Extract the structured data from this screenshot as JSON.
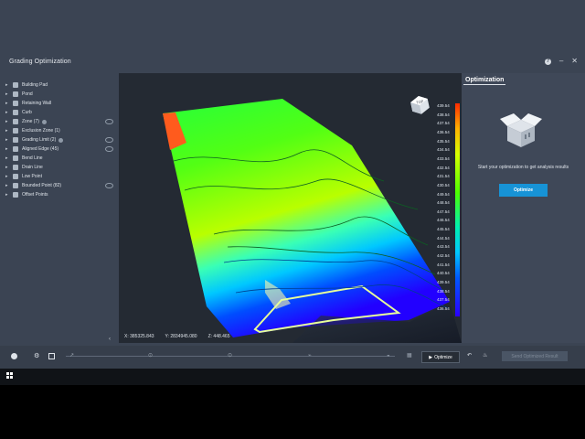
{
  "app": {
    "title": "Grading Optimization"
  },
  "window_controls": {
    "help": "?",
    "minimize": "–",
    "close": "✕"
  },
  "sidebar": {
    "items": [
      {
        "label": "Building Pad",
        "icon": "building-pad-icon",
        "info": false,
        "eye": false
      },
      {
        "label": "Pond",
        "icon": "pond-icon",
        "info": false,
        "eye": false
      },
      {
        "label": "Retaining Wall",
        "icon": "retaining-wall-icon",
        "info": false,
        "eye": false
      },
      {
        "label": "Curb",
        "icon": "curb-icon",
        "info": false,
        "eye": false
      },
      {
        "label": "Zone (7)",
        "icon": "zone-icon",
        "info": true,
        "eye": true
      },
      {
        "label": "Exclusion Zone (1)",
        "icon": "exclusion-zone-icon",
        "info": false,
        "eye": false
      },
      {
        "label": "Grading Limit (2)",
        "icon": "grading-limit-icon",
        "info": true,
        "eye": true
      },
      {
        "label": "Aligned Edge (45)",
        "icon": "aligned-edge-icon",
        "info": false,
        "eye": true
      },
      {
        "label": "Bend Line",
        "icon": "bend-line-icon",
        "info": false,
        "eye": false
      },
      {
        "label": "Drain Line",
        "icon": "drain-line-icon",
        "info": false,
        "eye": false
      },
      {
        "label": "Low Point",
        "icon": "low-point-icon",
        "info": false,
        "eye": false
      },
      {
        "label": "Bounded Point (82)",
        "icon": "bounded-point-icon",
        "info": false,
        "eye": true
      },
      {
        "label": "Offset Points",
        "icon": "offset-points-icon",
        "info": false,
        "eye": false
      }
    ]
  },
  "viewport": {
    "coords": {
      "x": "X: 385325.843",
      "y": "Y: 2834945.080",
      "z": "Z: 448.465"
    },
    "view_cube_label": "TOP",
    "legend": [
      "439.54",
      "438.54",
      "437.54",
      "436.54",
      "435.54",
      "434.54",
      "433.54",
      "432.54",
      "431.54",
      "430.54",
      "449.54",
      "448.54",
      "447.54",
      "446.54",
      "445.54",
      "444.54",
      "443.54",
      "442.54",
      "441.54",
      "440.54",
      "439.54",
      "438.54",
      "437.54",
      "436.54"
    ],
    "colors": {
      "high": "#ff2a00",
      "mid": "#4cff00",
      "low": "#2a00ff"
    }
  },
  "panel": {
    "title": "Optimization",
    "message": "Start your optimization to get analysis results",
    "button": "Optimize"
  },
  "bottombar": {
    "optimize_label": "Optimize",
    "send_label": "Send Optimized Result"
  }
}
